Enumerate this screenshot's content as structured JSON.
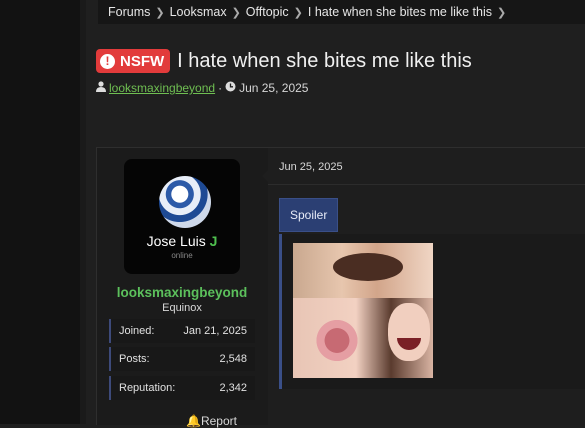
{
  "breadcrumb": [
    "Forums",
    "Looksmax",
    "Offtopic",
    "I hate when she bites me like this"
  ],
  "thread": {
    "badge": "NSFW",
    "title": "I hate when she bites me like this",
    "author": "looksmaxingbeyond",
    "date": "Jun 25, 2025"
  },
  "user": {
    "avatar_name": "Jose Luis",
    "avatar_tag": "J",
    "avatar_status": "online",
    "username": "looksmaxingbeyond",
    "user_title": "Equinox",
    "stats": [
      {
        "label": "Joined:",
        "value": "Jan 21, 2025"
      },
      {
        "label": "Posts:",
        "value": "2,548"
      },
      {
        "label": "Reputation:",
        "value": "2,342"
      }
    ]
  },
  "post": {
    "date": "Jun 25, 2025",
    "spoiler_label": "Spoiler",
    "report_label": "Report"
  },
  "colors": {
    "badge": "#e23b3b",
    "username": "#5cc05c",
    "spoiler": "#2b3f73"
  }
}
